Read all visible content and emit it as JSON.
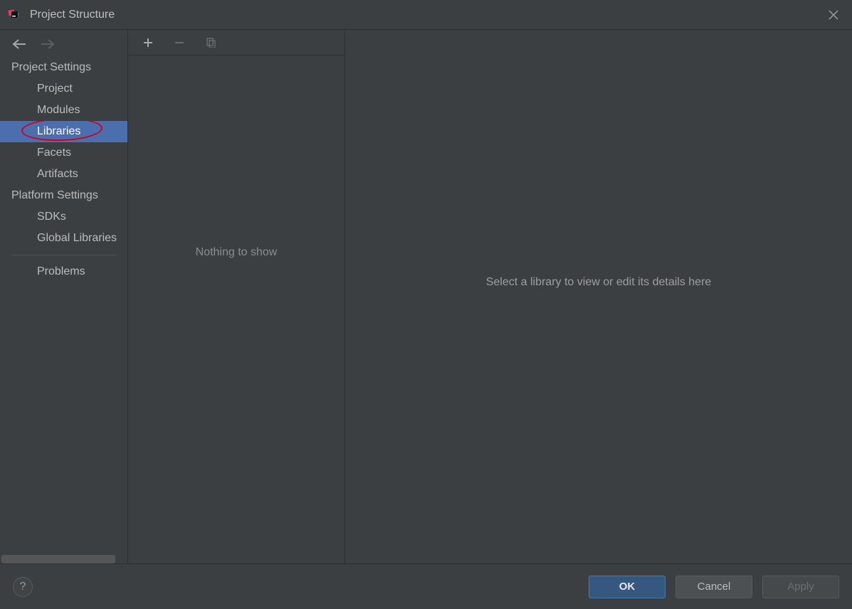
{
  "window": {
    "title": "Project Structure"
  },
  "nav": {
    "project_settings_header": "Project Settings",
    "platform_settings_header": "Platform Settings",
    "items": {
      "project": "Project",
      "modules": "Modules",
      "libraries": "Libraries",
      "facets": "Facets",
      "artifacts": "Artifacts",
      "sdks": "SDKs",
      "global_libraries": "Global Libraries",
      "problems": "Problems"
    },
    "selected": "libraries"
  },
  "midpanel": {
    "empty_text": "Nothing to show"
  },
  "detail": {
    "placeholder": "Select a library to view or edit its details here"
  },
  "buttons": {
    "ok": "OK",
    "cancel": "Cancel",
    "apply": "Apply",
    "help": "?"
  }
}
